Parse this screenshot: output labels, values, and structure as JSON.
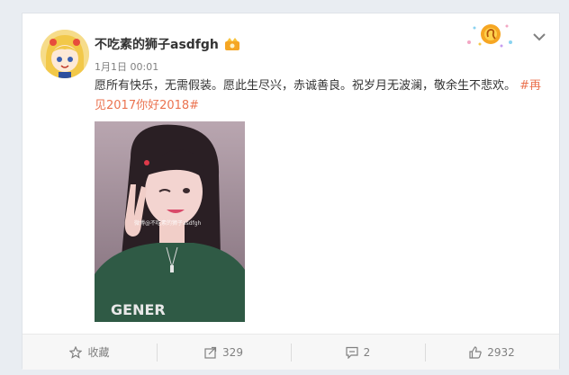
{
  "post": {
    "user_name": "不吃素的狮子asdfgh",
    "time": "1月1日 00:01",
    "text": "愿所有快乐，无需假装。愿此生尽兴，赤诚善良。祝岁月无波澜，敬余生不悲欢。",
    "hashtag": "#再见2017你好2018#",
    "watermark": "微博@不吃素的狮子asdfgh"
  },
  "actions": {
    "favorite_label": "收藏",
    "repost_count": "329",
    "comment_count": "2",
    "like_count": "2932"
  },
  "colors": {
    "accent": "#eb7350",
    "background": "#e9edf2",
    "sweater_green": "#2f5a45"
  },
  "icons": [
    "avatar-icon",
    "vip-badge-icon",
    "zodiac-leo-icon",
    "chevron-down-icon",
    "star-icon",
    "repost-icon",
    "comment-icon",
    "thumbs-up-icon"
  ]
}
